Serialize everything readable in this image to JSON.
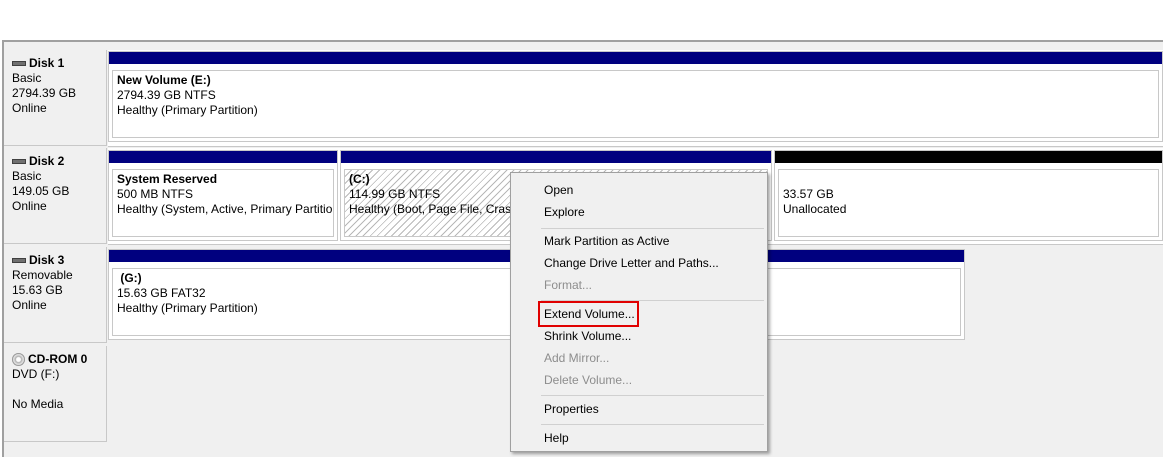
{
  "disks": [
    {
      "name": "Disk 1",
      "type": "Basic",
      "size": "2794.39 GB",
      "status": "Online"
    },
    {
      "name": "Disk 2",
      "type": "Basic",
      "size": "149.05 GB",
      "status": "Online"
    },
    {
      "name": "Disk 3",
      "type": "Removable",
      "size": "15.63 GB",
      "status": "Online"
    },
    {
      "name": "CD-ROM 0",
      "type": "DVD (F:)",
      "size": "",
      "status": "No Media"
    }
  ],
  "partitions": {
    "new_volume": {
      "title": "New Volume  (E:)",
      "size": "2794.39 GB NTFS",
      "health": "Healthy (Primary Partition)"
    },
    "system_reserved": {
      "title": "System Reserved",
      "size": "500 MB NTFS",
      "health": "Healthy (System, Active, Primary Partitio"
    },
    "c_drive": {
      "title": "(C:)",
      "size": "114.99 GB NTFS",
      "health": "Healthy (Boot, Page File, Crash"
    },
    "unallocated": {
      "size": "33.57 GB",
      "health": "Unallocated"
    },
    "g_drive": {
      "title": "(G:)",
      "size": "15.63 GB FAT32",
      "health": "Healthy (Primary Partition)"
    }
  },
  "context_menu": {
    "open": "Open",
    "explore": "Explore",
    "mark_active": "Mark Partition as Active",
    "change_letter": "Change Drive Letter and Paths...",
    "format": "Format...",
    "extend": "Extend Volume...",
    "shrink": "Shrink Volume...",
    "add_mirror": "Add Mirror...",
    "delete": "Delete Volume...",
    "properties": "Properties",
    "help": "Help"
  },
  "colors": {
    "partition_bar": "#00007f",
    "unallocated_bar": "#000000",
    "highlight": "#e00000"
  }
}
